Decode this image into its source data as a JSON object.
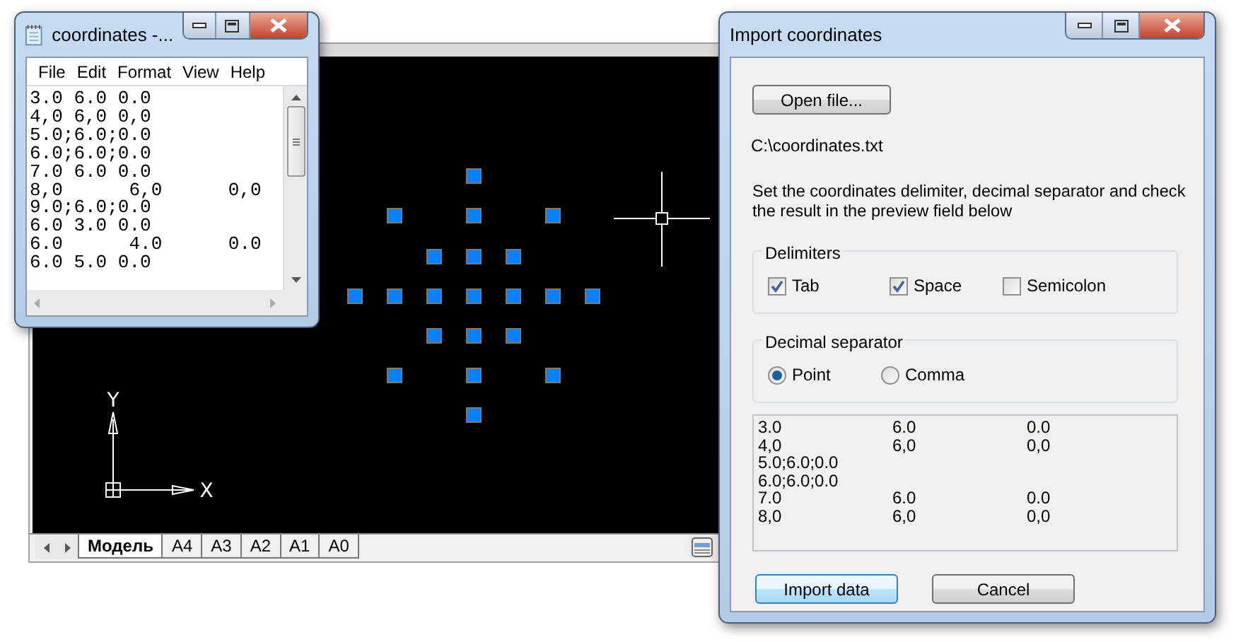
{
  "cad_window": {
    "axis_labels": [
      "Y",
      "X"
    ],
    "tabs": [
      {
        "label": "Модель",
        "selected": true
      },
      {
        "label": "A4",
        "selected": false
      },
      {
        "label": "A3",
        "selected": false
      },
      {
        "label": "A2",
        "selected": false
      },
      {
        "label": "A1",
        "selected": false
      },
      {
        "label": "A0",
        "selected": false
      }
    ]
  },
  "notepad": {
    "title": "coordinates -...",
    "menu": [
      "File",
      "Edit",
      "Format",
      "View",
      "Help"
    ],
    "lines": [
      "3.0 6.0 0.0",
      "4,0 6,0 0,0",
      "5.0;6.0;0.0",
      "6.0;6.0;0.0",
      "7.0 6.0 0.0",
      "8,0      6,0      0,0",
      "9.0;6.0;0.0",
      "6.0 3.0 0.0",
      "6.0      4.0      0.0",
      "6.0 5.0 0.0"
    ]
  },
  "dialog": {
    "title": "Import coordinates",
    "open_button": "Open file...",
    "file_path": "C:\\coordinates.txt",
    "description": "Set the coordinates delimiter, decimal separator and check the result in the preview field below",
    "delimiters": {
      "title": "Delimiters",
      "options": [
        {
          "label": "Tab",
          "checked": true
        },
        {
          "label": "Space",
          "checked": true
        },
        {
          "label": "Semicolon",
          "checked": false
        }
      ]
    },
    "decimal_separator": {
      "title": "Decimal separator",
      "options": [
        {
          "label": "Point",
          "selected": true
        },
        {
          "label": "Comma",
          "selected": false
        }
      ]
    },
    "preview_rows": [
      {
        "cells": [
          "3.0",
          "6.0",
          "0.0"
        ]
      },
      {
        "cells": [
          "4,0",
          "6,0",
          "0,0"
        ]
      },
      {
        "cells": [
          "5.0;6.0;0.0"
        ]
      },
      {
        "cells": [
          "6.0;6.0;0.0"
        ]
      },
      {
        "cells": [
          "7.0",
          "6.0",
          "0.0"
        ]
      },
      {
        "cells": [
          "8,0",
          "6,0",
          "0,0"
        ]
      }
    ],
    "buttons": [
      {
        "label": "Import data",
        "kind": "default"
      },
      {
        "label": "Cancel",
        "kind": "normal"
      }
    ]
  }
}
